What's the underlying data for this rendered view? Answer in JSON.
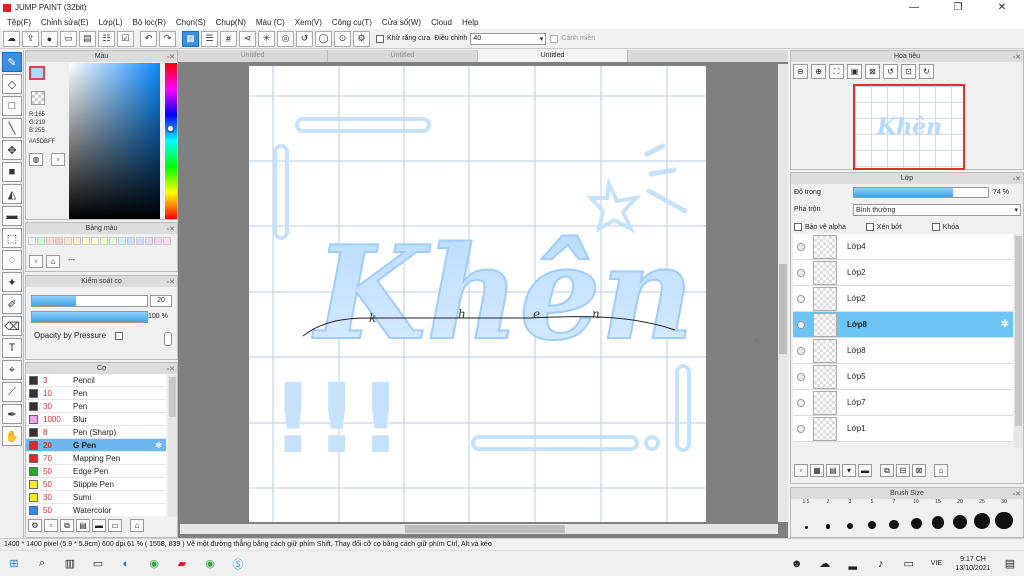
{
  "window": {
    "title": "JUMP PAINT (32bit)"
  },
  "menu": [
    "Tệp(F)",
    "Chỉnh sửa(E)",
    "Lớp(L)",
    "Bộ lọc(R)",
    "Chọn(S)",
    "Chụp(N)",
    "Màu (C)",
    "Xem(V)",
    "Công cụ(T)",
    "Cửa sổ(W)",
    "Cloud",
    "Help"
  ],
  "toolbar": {
    "antialias_label": "Khử răng cưa",
    "adjust_label": "Điều chỉnh",
    "adjust_value": "40",
    "warning_label": "Cảnh miền"
  },
  "doc_tabs": [
    "Untitled",
    "Untitled",
    "Untitled"
  ],
  "color_panel": {
    "title": "Màu",
    "r": "R:165",
    "g": "G:219",
    "b": "B:255",
    "hex": "#A5DBFF",
    "current_color": "#A5DBFF"
  },
  "palette_panel": {
    "title": "Bảng màu",
    "empty_label": "---",
    "swatches": [
      "#e8f2ff",
      "#c8ffc8",
      "#ffd8d8",
      "#ffc8c8",
      "#ffe0c8",
      "#ffecc8",
      "#fff8c8",
      "#ffffd0",
      "#e8ffc8",
      "#d8ffd8",
      "#d0f0ff",
      "#c8e0ff",
      "#d8d8ff",
      "#e8d8ff",
      "#f8d0ff",
      "#ffd8f0"
    ]
  },
  "brush_control": {
    "title": "Kiểm soát cọ",
    "size_value": "20",
    "opacity_value": "100 %",
    "opacity_level": 1,
    "size_level": 0.38,
    "pressure_label": "Opacity by Pressure"
  },
  "brush_panel": {
    "title": "Cọ",
    "items": [
      {
        "size": "3",
        "name": "Pencil",
        "color": "#333333"
      },
      {
        "size": "10",
        "name": "Pen",
        "color": "#333333"
      },
      {
        "size": "30",
        "name": "Pen",
        "color": "#333333"
      },
      {
        "size": "1000",
        "name": "Blur",
        "color": "#f4a4ec"
      },
      {
        "size": "8",
        "name": "Pen (Sharp)",
        "color": "#333333"
      },
      {
        "size": "20",
        "name": "G Pen",
        "color": "#e0262b"
      },
      {
        "size": "70",
        "name": "Mapping Pen",
        "color": "#e0262b"
      },
      {
        "size": "50",
        "name": "Edge Pen",
        "color": "#22aa33"
      },
      {
        "size": "50",
        "name": "Stipple Pen",
        "color": "#eeee22"
      },
      {
        "size": "30",
        "name": "Sumi",
        "color": "#eeee22"
      },
      {
        "size": "50",
        "name": "Watercolor",
        "color": "#3388ee"
      }
    ]
  },
  "navigator": {
    "title": "Hoa tiêu"
  },
  "layer_panel": {
    "title": "Lớp",
    "opacity_label": "Độ trong",
    "opacity_value": "74 %",
    "opacity_level": 0.74,
    "blend_label": "Pha trộn",
    "blend_value": "Bình thường",
    "protect_alpha": "Bảo vệ alpha",
    "clipping": "Xén bớt",
    "lock": "Khóa",
    "layers": [
      "Lớp4",
      "Lớp2",
      "Lớp2",
      "Lớp8",
      "Lớp8",
      "Lớp5",
      "Lớp7",
      "Lớp1"
    ]
  },
  "brush_size_panel": {
    "title": "Brush Size",
    "sizes": [
      "1.5",
      "2",
      "3",
      "5",
      "7",
      "10",
      "15",
      "20",
      "25",
      "30"
    ]
  },
  "status": {
    "text": "1400 * 1400 pixel  (5.9 * 5.9cm)  600 dpi  61 %  ( 1558, 839 )  Vẽ một đường thẳng bằng cách giữ phím Shift, Thay đổi cỡ cọ bằng cách giữ phím Ctrl, Alt và kéo"
  },
  "taskbar": {
    "lang": "VIE",
    "time": "9:17 CH",
    "date": "13/10/2021"
  },
  "artwork": {
    "word": "Khên",
    "sketch_letters": [
      "k",
      "h",
      "e",
      "n"
    ],
    "exclaim": "!!!"
  }
}
